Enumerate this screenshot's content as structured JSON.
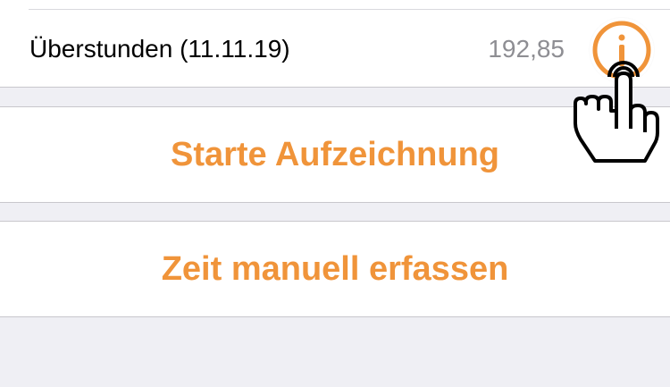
{
  "overtime_row": {
    "label": "Überstunden (11.11.19)",
    "value": "192,85",
    "info_icon": "info-circle-icon"
  },
  "actions": {
    "start_recording": "Starte Aufzeichnung",
    "manual_entry": "Zeit manuell erfassen"
  },
  "overlay": {
    "icon": "tap-hand-icon"
  },
  "colors": {
    "accent": "#f0943a",
    "background": "#efeff4",
    "cell": "#ffffff",
    "secondary_text": "#8e8e93"
  }
}
